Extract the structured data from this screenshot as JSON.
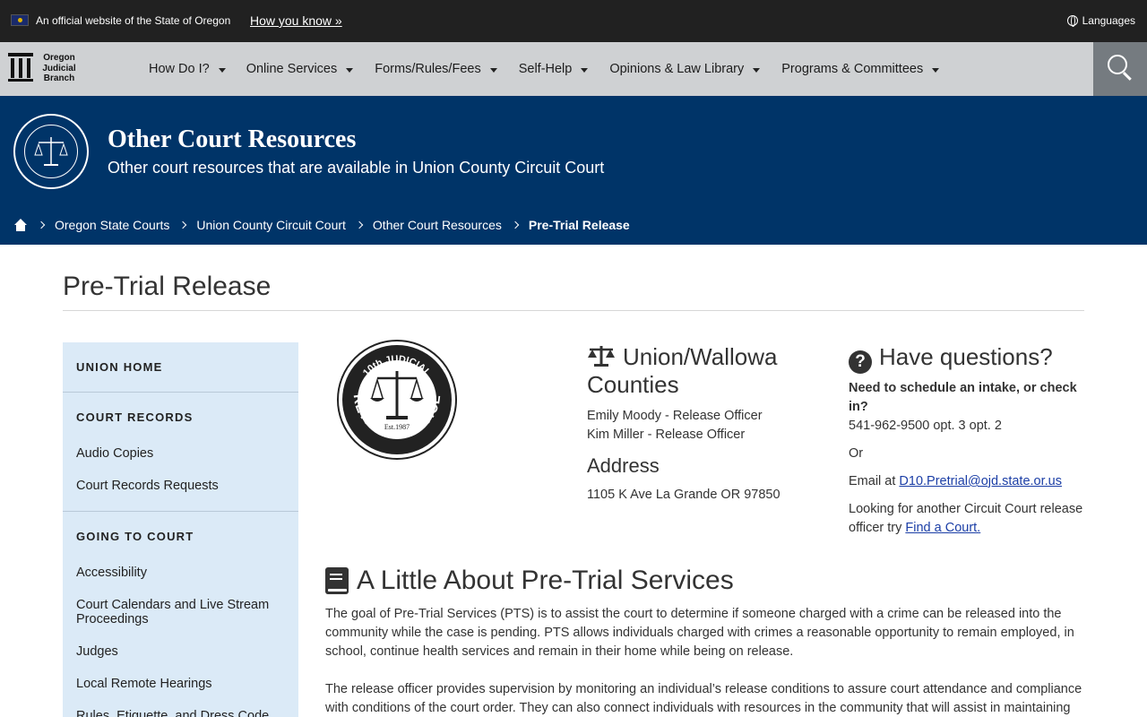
{
  "topbar": {
    "official_text": "An official website of the State of Oregon",
    "how_you_know": "How you know »",
    "languages": "Languages",
    "icons": [
      "oregon-flag-icon",
      "globe-icon"
    ]
  },
  "nav": {
    "logo_lines": [
      "Oregon",
      "Judicial",
      "Branch"
    ],
    "items": [
      {
        "label": "How Do I?"
      },
      {
        "label": "Online Services"
      },
      {
        "label": "Forms/Rules/Fees"
      },
      {
        "label": "Self-Help"
      },
      {
        "label": "Opinions & Law Library"
      },
      {
        "label": "Programs & Committees"
      }
    ]
  },
  "banner": {
    "title": "Other Court Resources",
    "subtitle": "Other court resources that are available in Union County Circuit Court",
    "breadcrumbs": [
      "Oregon State Courts",
      "Union County Circuit Court",
      "Other Court Resources",
      "Pre-Trial Release"
    ]
  },
  "page": {
    "title": "Pre-Trial Release"
  },
  "sidebar": {
    "union_home": "UNION HOME",
    "court_records": "COURT RECORDS",
    "court_records_links": [
      "Audio Copies",
      "Court Records Requests"
    ],
    "going_to_court": "GOING TO COURT",
    "going_links": [
      "Accessibility",
      "Court Calendars and Live Stream Proceedings",
      "Judges",
      "Local Remote Hearings",
      "Rules, Etiquette, and Dress Code"
    ]
  },
  "logo_pts": {
    "top": "10th JUDICIAL",
    "bottom": "PRETRIAL SERVICES",
    "est": "Est.1987"
  },
  "counties": {
    "heading": "Union/Wallowa Counties",
    "officers": [
      "Emily Moody - Release Officer",
      "Kim Miller - Release Officer"
    ],
    "address_heading": "Address",
    "address": "1105 K Ave La Grande OR 97850"
  },
  "questions": {
    "heading": "Have questions?",
    "bold_q": "Need to schedule an intake, or check in?",
    "phone": "541-962-9500 opt. 3 opt. 2",
    "or": "Or",
    "email_prefix": "Email at",
    "email": "D10.Pretrial@ojd.state.or.us",
    "looking": "Looking for another Circuit Court release officer try",
    "find_court": "Find a Court."
  },
  "about": {
    "heading": "A Little About Pre-Trial Services",
    "p1": "The goal of Pre-Trial Services (PTS) is to assist the court to determine if someone charged with a crime can be released into the community while the case is pending. PTS allows individuals charged with crimes a reasonable opportunity to remain employed, in school, continue health services and remain in their home while being on release.",
    "p2": "The release officer provides supervision by monitoring an individual’s release conditions to assure court attendance and compliance with conditions of the court order. They can also connect individuals with resources in the community that will assist in maintaining stability"
  }
}
